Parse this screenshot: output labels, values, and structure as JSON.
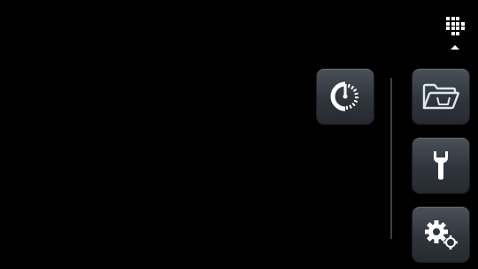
{
  "screen": {
    "background": "#000000",
    "accent": "#dbe7f3"
  },
  "icons": {
    "app_grid": "app-grid-icon",
    "collapse": "caret-up-icon",
    "timer": "timer-dial-icon",
    "folder": "wash-basket-folder-icon",
    "tools": "wrench-icon",
    "settings": "gears-icon"
  }
}
